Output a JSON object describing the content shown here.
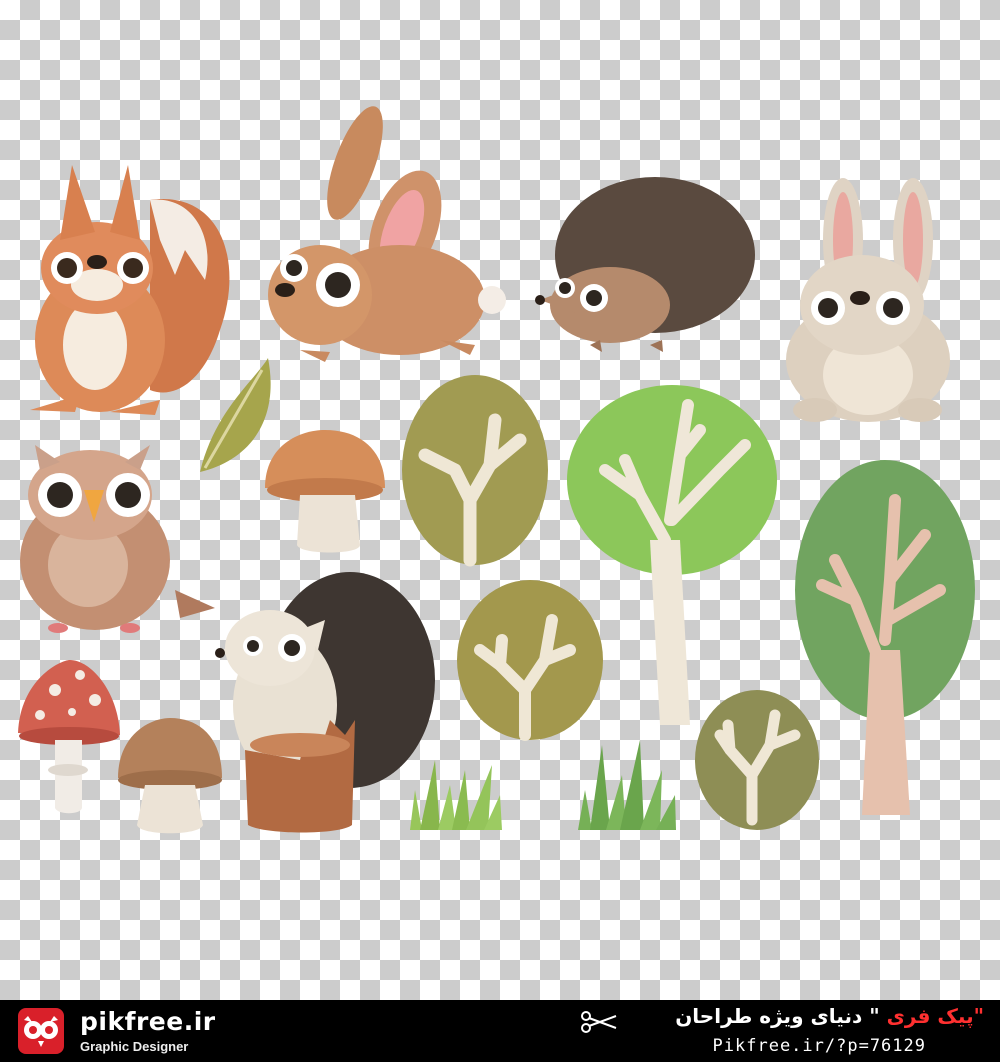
{
  "footer": {
    "brand": "pikfree.ir",
    "tagline": "Graphic Designer",
    "slogan_accent": "\"پیک فری",
    "slogan_rest": "\" دنیای ویژه طراحان",
    "url": "Pikfree.ir/?p=76129"
  },
  "colors": {
    "checker_light": "#ffffff",
    "checker_dark": "#cccccc",
    "footer_bg": "#000000",
    "brand_red": "#d9202a"
  },
  "icons": [
    "owl-logo-icon",
    "scissors-icon"
  ]
}
